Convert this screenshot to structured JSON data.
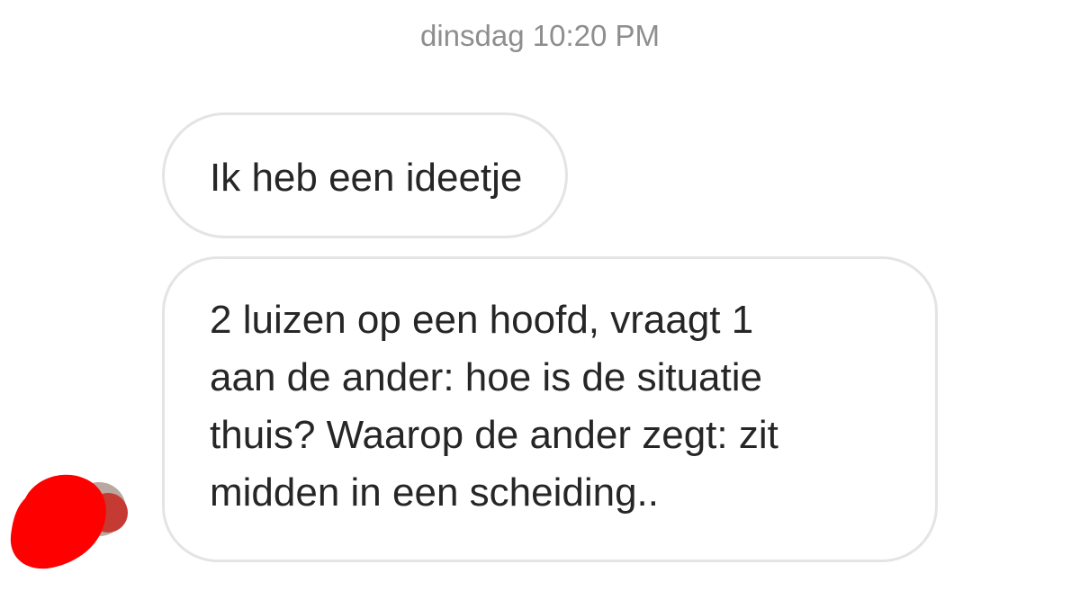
{
  "conversation": {
    "timestamp": "dinsdag 10:20 PM",
    "messages": [
      {
        "lines": [
          "Ik heb een ideetje"
        ]
      },
      {
        "lines": [
          "2 luizen op een hoofd, vraagt 1",
          "aan de ander: hoe is de situatie",
          "thuis? Waarop de ander zegt: zit",
          "midden in een scheiding.."
        ]
      }
    ]
  },
  "colors": {
    "timestamp_text": "#8e8e8e",
    "message_text": "#262626",
    "bubble_border": "#e4e4e4",
    "avatar_redaction": "#ff0000"
  },
  "avatar": {
    "icon": "avatar-redacted-red-scribble"
  }
}
